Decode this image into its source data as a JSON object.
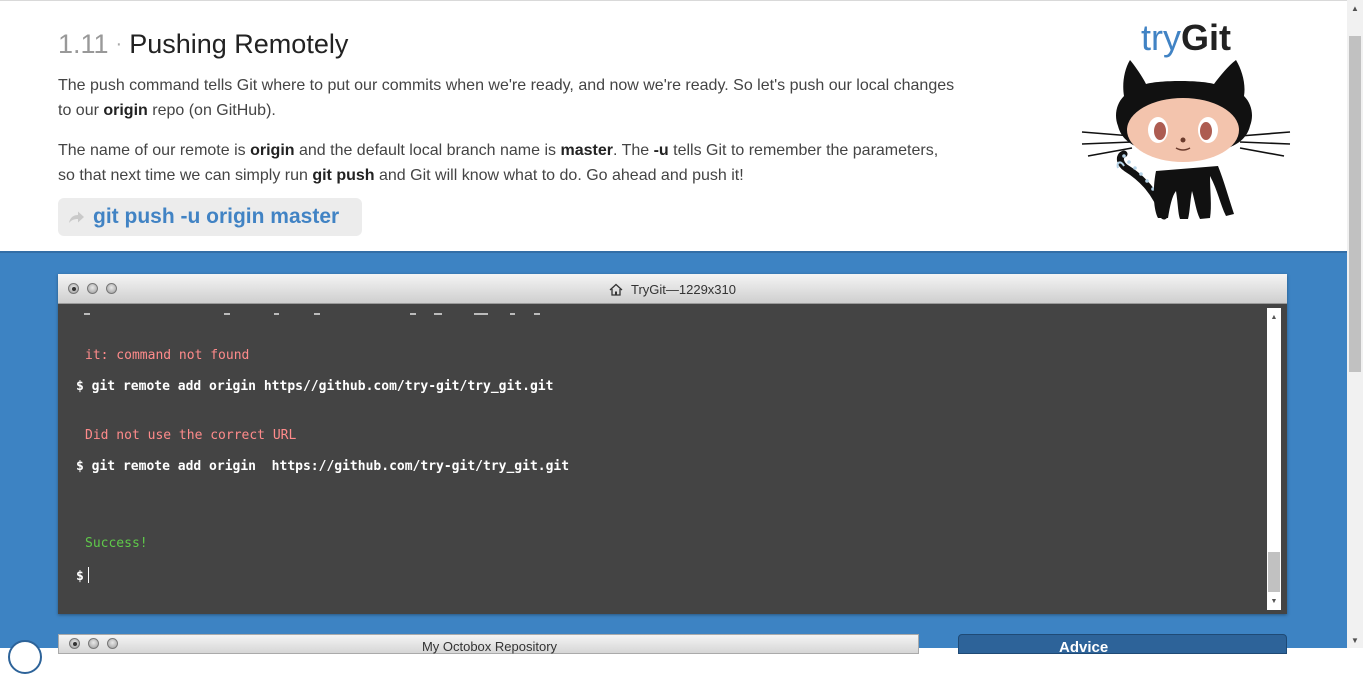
{
  "lesson": {
    "number": "1.11",
    "separator": "·",
    "title": "Pushing Remotely",
    "p1": {
      "t1": "The push command tells Git where to put our commits when we're ready, and now we're ready. So let's push our local changes to our ",
      "b1": "origin",
      "t2": " repo (on GitHub)."
    },
    "p2": {
      "t1": "The name of our remote is ",
      "b1": "origin",
      "t2": " and the default local branch name is ",
      "b2": "master",
      "t3": ". The ",
      "b3": "-u",
      "t4": " tells Git to remember the parameters, so that next time we can simply run ",
      "b4": "git push",
      "t5": " and Git will know what to do. Go ahead and push it!"
    },
    "command": "git push -u origin master"
  },
  "logo": {
    "try": "try",
    "git": "Git"
  },
  "terminal": {
    "title": "TryGit—1229x310",
    "lines": {
      "l1": "it: command not found",
      "l2": "$ git remote add origin https//github.com/try-git/try_git.git",
      "l3": "Did not use the correct URL",
      "l4": "$ git remote add origin  https://github.com/try-git/try_git.git",
      "l5": "Success!",
      "prompt": "$"
    }
  },
  "bottom": {
    "window2_title": "My Octobox Repository",
    "window3_title": "Advice"
  },
  "colors": {
    "link_blue": "#4183c4",
    "panel_blue": "#3d83c3",
    "terminal_bg": "#444444",
    "error_red": "#ff8b8b",
    "success_green": "#5fc94a"
  },
  "icons": {
    "command_arrow": "share-arrow-icon",
    "terminal_title": "home-icon",
    "mascot": "octocat-icon"
  }
}
